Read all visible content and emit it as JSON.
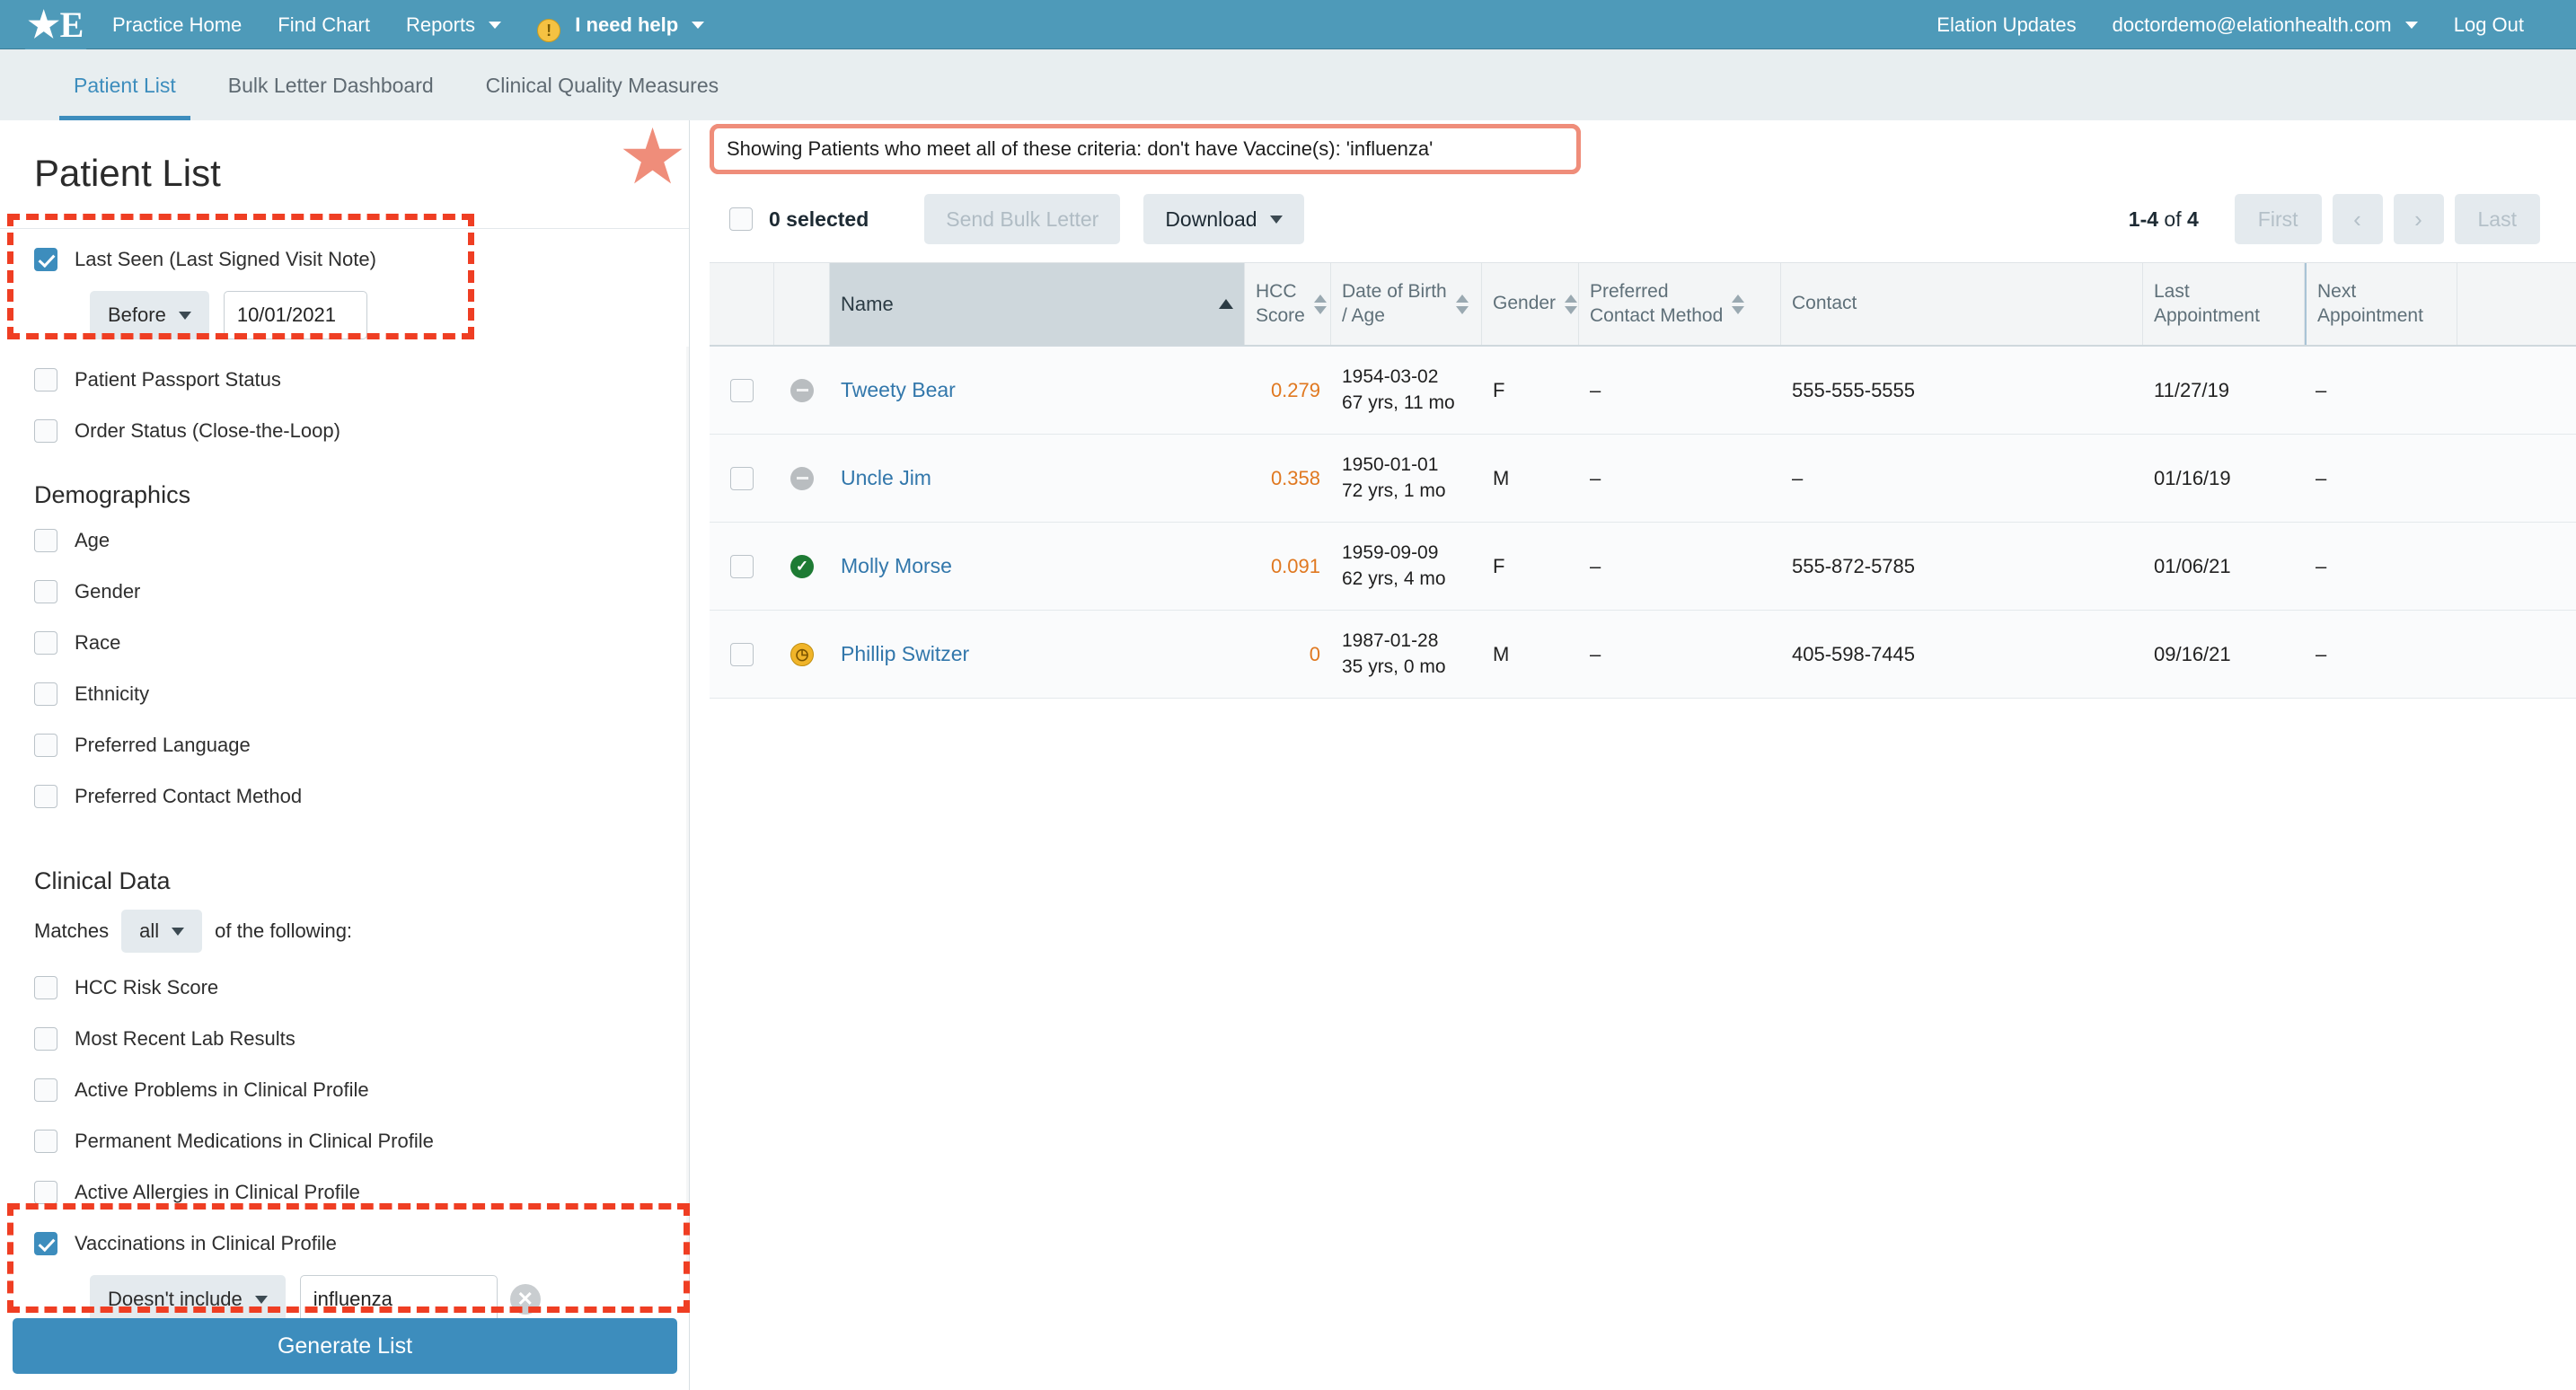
{
  "topnav": {
    "logo_icon": "elation-logo-icon",
    "left_items": [
      {
        "label": "Practice Home",
        "caret": false
      },
      {
        "label": "Find Chart",
        "caret": false
      },
      {
        "label": "Reports",
        "caret": true
      }
    ],
    "help": {
      "label": "I need help",
      "icon": "alert-circle-icon"
    },
    "right_items": [
      {
        "label": "Elation Updates",
        "caret": false
      },
      {
        "label": "doctordemo@elationhealth.com",
        "caret": true
      },
      {
        "label": "Log Out",
        "caret": false
      }
    ],
    "bg_color": "#4e9ab9"
  },
  "tabs": [
    {
      "label": "Patient List",
      "active": true
    },
    {
      "label": "Bulk Letter Dashboard",
      "active": false
    },
    {
      "label": "Clinical Quality Measures",
      "active": false
    }
  ],
  "sidebar": {
    "title": "Patient List",
    "last_seen": {
      "label": "Last Seen (Last Signed Visit Note)",
      "checked": true,
      "operator": "Before",
      "date_value": "10/01/2021"
    },
    "top_filters": [
      {
        "label": "Patient Passport Status",
        "checked": false
      },
      {
        "label": "Order Status (Close-the-Loop)",
        "checked": false
      }
    ],
    "demographics": {
      "heading": "Demographics",
      "items": [
        {
          "label": "Age",
          "checked": false
        },
        {
          "label": "Gender",
          "checked": false
        },
        {
          "label": "Race",
          "checked": false
        },
        {
          "label": "Ethnicity",
          "checked": false
        },
        {
          "label": "Preferred Language",
          "checked": false
        },
        {
          "label": "Preferred Contact Method",
          "checked": false
        }
      ]
    },
    "clinical_data": {
      "heading": "Clinical Data",
      "matches_prefix": "Matches",
      "matches_value": "all",
      "matches_suffix": "of the following:",
      "items": [
        {
          "label": "HCC Risk Score",
          "checked": false
        },
        {
          "label": "Most Recent Lab Results",
          "checked": false
        },
        {
          "label": "Active Problems in Clinical Profile",
          "checked": false
        },
        {
          "label": "Permanent Medications in Clinical Profile",
          "checked": false
        },
        {
          "label": "Active Allergies in Clinical Profile",
          "checked": false
        }
      ],
      "vaccinations": {
        "label": "Vaccinations in Clinical Profile",
        "checked": true,
        "operator": "Doesn't include",
        "value": "influenza",
        "clear_icon": "clear-x-icon"
      }
    },
    "generate_button": "Generate List"
  },
  "main": {
    "banner": "Showing Patients who meet all of these criteria: don't have Vaccine(s): 'influenza'",
    "banner_border_color": "#ef8d7a",
    "star_icon": "star-icon",
    "toolbar": {
      "selected_label": "0 selected",
      "send_bulk_letter": "Send Bulk Letter",
      "download": "Download"
    },
    "pager": {
      "range": "1-4",
      "of_text": "of",
      "total": "4",
      "first": "First",
      "prev_icon": "chevron-left-icon",
      "next_icon": "chevron-right-icon",
      "last": "Last"
    }
  },
  "table": {
    "columns": [
      {
        "key": "check",
        "label": "",
        "sortable": false
      },
      {
        "key": "status",
        "label": "",
        "sortable": false
      },
      {
        "key": "name",
        "label": "Name",
        "sortable": true,
        "sorted": "asc"
      },
      {
        "key": "hcc",
        "label": "HCC\nScore",
        "line1": "HCC",
        "line2": "Score",
        "sortable": true
      },
      {
        "key": "dob",
        "label": "Date of Birth / Age",
        "line1": "Date of Birth",
        "line2": "/ Age",
        "sortable": true
      },
      {
        "key": "gender",
        "label": "Gender",
        "line1": "Gender",
        "line2": "",
        "sortable": true
      },
      {
        "key": "pcm",
        "label": "Preferred Contact Method",
        "line1": "Preferred",
        "line2": "Contact Method",
        "sortable": true
      },
      {
        "key": "contact",
        "label": "Contact",
        "line1": "Contact",
        "line2": "",
        "sortable": false
      },
      {
        "key": "last_appt",
        "label": "Last Appointment",
        "line1": "Last",
        "line2": "Appointment",
        "sortable": false
      },
      {
        "key": "next_appt",
        "label": "Next Appointment",
        "line1": "Next",
        "line2": "Appointment",
        "sortable": false
      }
    ],
    "rows": [
      {
        "checked": false,
        "status_icon": "minus-circle-icon",
        "status_kind": "grey",
        "name": "Tweety Bear",
        "hcc": "0.279",
        "dob": "1954-03-02",
        "age": "67 yrs, 11 mo",
        "gender": "F",
        "pcm": "–",
        "contact": "555-555-5555",
        "last_appt": "11/27/19",
        "next_appt": "–"
      },
      {
        "checked": false,
        "status_icon": "minus-circle-icon",
        "status_kind": "grey",
        "name": "Uncle Jim",
        "hcc": "0.358",
        "dob": "1950-01-01",
        "age": "72 yrs, 1 mo",
        "gender": "M",
        "pcm": "–",
        "contact": "–",
        "last_appt": "01/16/19",
        "next_appt": "–"
      },
      {
        "checked": false,
        "status_icon": "check-circle-icon",
        "status_kind": "green",
        "name": "Molly Morse",
        "hcc": "0.091",
        "dob": "1959-09-09",
        "age": "62 yrs, 4 mo",
        "gender": "F",
        "pcm": "–",
        "contact": "555-872-5785",
        "last_appt": "01/06/21",
        "next_appt": "–"
      },
      {
        "checked": false,
        "status_icon": "clock-circle-icon",
        "status_kind": "amber",
        "name": "Phillip Switzer",
        "hcc": "0",
        "dob": "1987-01-28",
        "age": "35 yrs, 0 mo",
        "gender": "M",
        "pcm": "–",
        "contact": "405-598-7445",
        "last_appt": "09/16/21",
        "next_appt": "–"
      }
    ]
  },
  "annotations": {
    "dash_color": "#ef3e23",
    "boxes": [
      "last-seen-filter-highlight",
      "vaccinations-filter-highlight",
      "criteria-banner-highlight"
    ]
  }
}
